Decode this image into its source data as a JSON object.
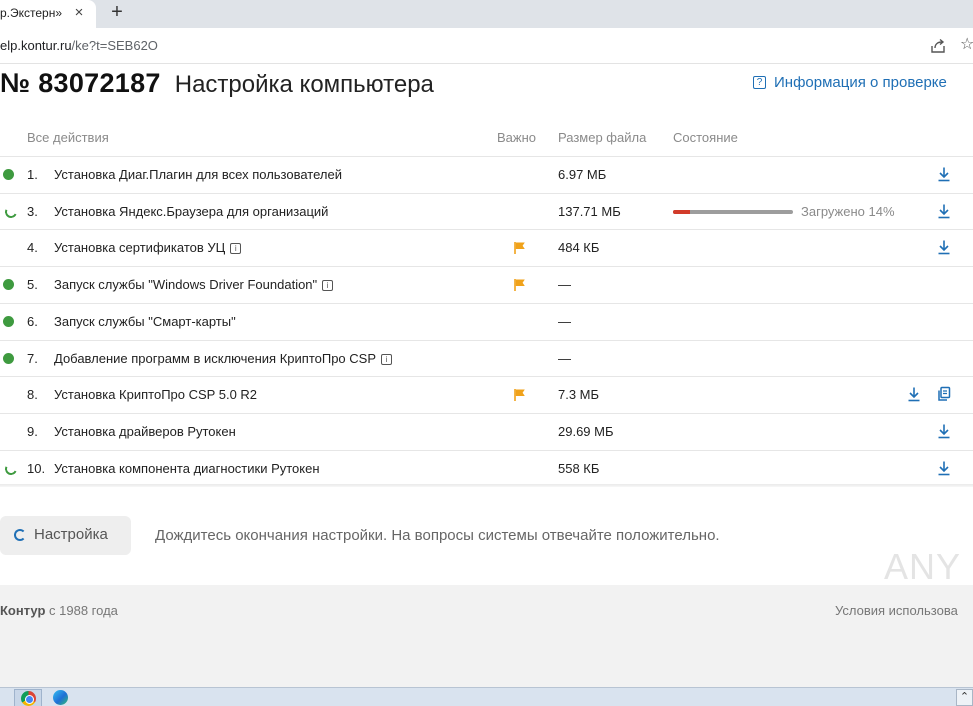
{
  "browser": {
    "tab_title": "р.Экстерн»",
    "tab_close": "×",
    "new_tab": "+",
    "url_domain": "elp.kontur.ru",
    "url_path": "/ke?t=SEB62O",
    "star": "☆"
  },
  "page": {
    "number": "№ 83072187",
    "title": "Настройка компьютера",
    "info_link": "Информация о проверке",
    "info_link_icon": "?"
  },
  "table": {
    "headers": {
      "actions": "Все действия",
      "important": "Важно",
      "size": "Размер файла",
      "status": "Состояние"
    },
    "rows": [
      {
        "status": "done",
        "num": "1.",
        "name": "Установка Диаг.Плагин для всех пользователей",
        "info": false,
        "important": false,
        "size": "6.97 МБ",
        "download": true,
        "copy": false
      },
      {
        "status": "loading",
        "num": "3.",
        "name": "Установка Яндекс.Браузера для организаций",
        "info": false,
        "important": false,
        "size": "137.71 МБ",
        "progress": 14,
        "progress_text": "Загружено 14%",
        "download": true,
        "copy": false
      },
      {
        "status": "none",
        "num": "4.",
        "name": "Установка сертификатов УЦ",
        "info": true,
        "important": true,
        "size": "484 КБ",
        "download": true,
        "copy": false
      },
      {
        "status": "done",
        "num": "5.",
        "name": "Запуск службы \"Windows Driver Foundation\"",
        "info": true,
        "important": true,
        "size": "—",
        "download": false,
        "copy": false
      },
      {
        "status": "done",
        "num": "6.",
        "name": "Запуск службы \"Смарт-карты\"",
        "info": false,
        "important": false,
        "size": "—",
        "download": false,
        "copy": false
      },
      {
        "status": "done",
        "num": "7.",
        "name": "Добавление программ в исключения КриптоПро CSP",
        "info": true,
        "important": false,
        "size": "—",
        "download": false,
        "copy": false
      },
      {
        "status": "none",
        "num": "8.",
        "name": "Установка КриптоПро CSP 5.0 R2",
        "info": false,
        "important": true,
        "size": "7.3 МБ",
        "download": true,
        "copy": true
      },
      {
        "status": "none",
        "num": "9.",
        "name": "Установка драйверов Рутокен",
        "info": false,
        "important": false,
        "size": "29.69 МБ",
        "download": true,
        "copy": false
      },
      {
        "status": "loading",
        "num": "10.",
        "name": "Установка компонента диагностики Рутокен",
        "info": false,
        "important": false,
        "size": "558 КБ",
        "download": true,
        "copy": false
      }
    ],
    "info_glyph": "i"
  },
  "actions": {
    "setup_button": "Настройка",
    "hint": "Дождитесь окончания настройки. На вопросы системы отвечайте положительно."
  },
  "footer": {
    "brand": "Контур",
    "since": " с 1988 года",
    "terms": "Условия использова"
  },
  "watermark": "ANY",
  "taskbar": {
    "tray_glyph": "⌃"
  },
  "colors": {
    "done": "#3e9a3f",
    "link": "#1f6fb5",
    "flag": "#f0a21a",
    "progress_fill": "#d23b2a",
    "progress_track": "#9d9d9d"
  }
}
